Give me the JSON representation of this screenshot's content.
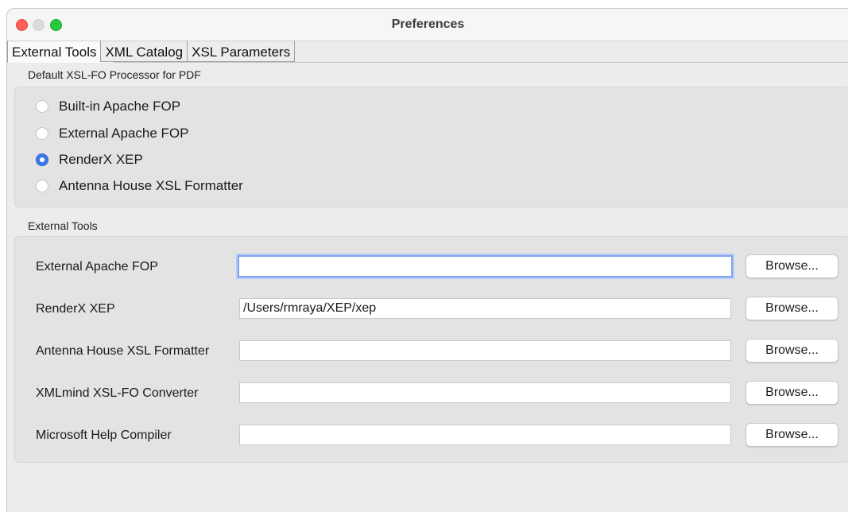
{
  "window": {
    "title": "Preferences"
  },
  "tabs": [
    {
      "label": "External Tools",
      "selected": true
    },
    {
      "label": "XML Catalog",
      "selected": false
    },
    {
      "label": "XSL Parameters",
      "selected": false
    }
  ],
  "processor": {
    "label": "Default XSL-FO Processor for PDF",
    "options": [
      {
        "label": "Built-in Apache FOP",
        "checked": false
      },
      {
        "label": "External Apache FOP",
        "checked": false
      },
      {
        "label": "RenderX XEP",
        "checked": true
      },
      {
        "label": "Antenna House XSL Formatter",
        "checked": false
      }
    ]
  },
  "tools": {
    "label": "External Tools",
    "rows": [
      {
        "label": "External Apache FOP",
        "value": "",
        "browse": "Browse..."
      },
      {
        "label": "RenderX XEP",
        "value": "/Users/rmraya/XEP/xep",
        "browse": "Browse..."
      },
      {
        "label": "Antenna House XSL Formatter",
        "value": "",
        "browse": "Browse..."
      },
      {
        "label": "XMLmind XSL-FO Converter",
        "value": "",
        "browse": "Browse..."
      },
      {
        "label": "Microsoft Help Compiler",
        "value": "",
        "browse": "Browse..."
      }
    ]
  },
  "colors": {
    "accent": "#3b78e7",
    "close": "#fe5f57",
    "maximize": "#28c840"
  }
}
